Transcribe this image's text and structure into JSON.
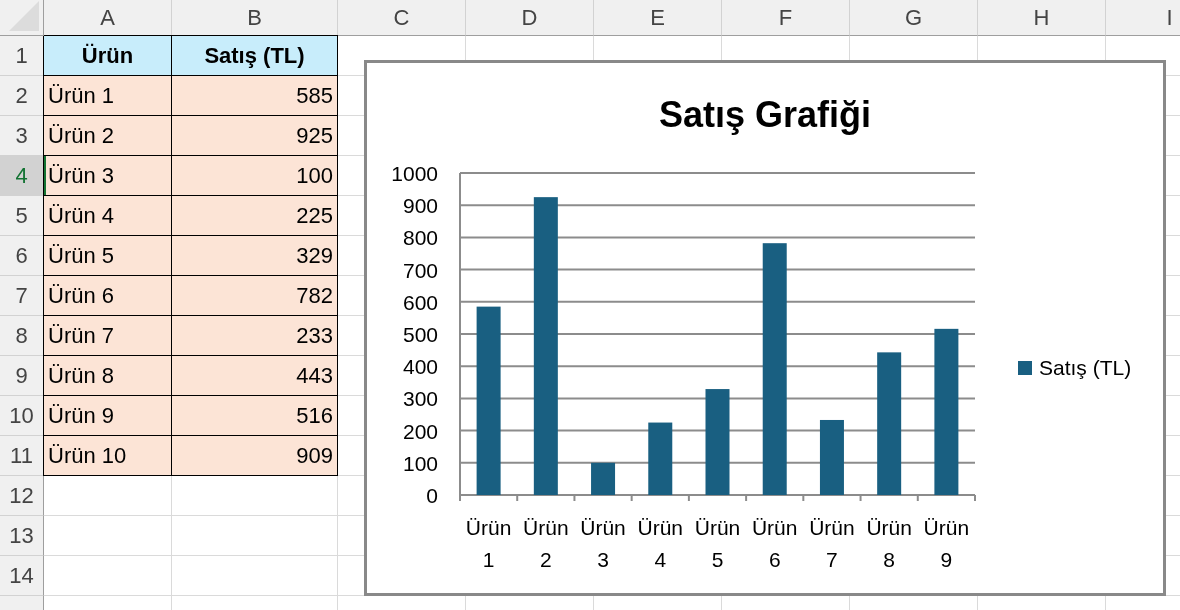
{
  "columns": [
    {
      "label": "A",
      "selected": false
    },
    {
      "label": "B",
      "selected": false
    },
    {
      "label": "C",
      "selected": false
    },
    {
      "label": "D",
      "selected": false
    },
    {
      "label": "E",
      "selected": false
    },
    {
      "label": "F",
      "selected": false
    },
    {
      "label": "G",
      "selected": false
    },
    {
      "label": "H",
      "selected": false
    },
    {
      "label": "I",
      "selected": false
    }
  ],
  "rows": [
    {
      "label": "1",
      "selected": false
    },
    {
      "label": "2",
      "selected": false
    },
    {
      "label": "3",
      "selected": false
    },
    {
      "label": "4",
      "selected": true
    },
    {
      "label": "5",
      "selected": false
    },
    {
      "label": "6",
      "selected": false
    },
    {
      "label": "7",
      "selected": false
    },
    {
      "label": "8",
      "selected": false
    },
    {
      "label": "9",
      "selected": false
    },
    {
      "label": "10",
      "selected": false
    },
    {
      "label": "11",
      "selected": false
    },
    {
      "label": "12",
      "selected": false
    },
    {
      "label": "13",
      "selected": false
    },
    {
      "label": "14",
      "selected": false
    }
  ],
  "table": {
    "columns": [
      "Ürün",
      "Satış (TL)"
    ],
    "rows": [
      [
        "Ürün 1",
        "585"
      ],
      [
        "Ürün 2",
        "925"
      ],
      [
        "Ürün 3",
        "100"
      ],
      [
        "Ürün 4",
        "225"
      ],
      [
        "Ürün 5",
        "329"
      ],
      [
        "Ürün 6",
        "782"
      ],
      [
        "Ürün 7",
        "233"
      ],
      [
        "Ürün 8",
        "443"
      ],
      [
        "Ürün 9",
        "516"
      ],
      [
        "Ürün 10",
        "909"
      ]
    ]
  },
  "chart": {
    "chart_data": {
      "type": "bar",
      "title": "Satış Grafiği",
      "categories": [
        "Ürün 1",
        "Ürün 2",
        "Ürün 3",
        "Ürün 4",
        "Ürün 5",
        "Ürün 6",
        "Ürün 7",
        "Ürün 8",
        "Ürün 9"
      ],
      "series": [
        {
          "name": "Satış (TL)",
          "color": "#195f81",
          "values": [
            585,
            925,
            100,
            225,
            329,
            782,
            233,
            443,
            516
          ]
        }
      ],
      "grid": true,
      "ylim": [
        0,
        1000
      ],
      "yticks": [
        0,
        100,
        200,
        300,
        400,
        500,
        600,
        700,
        800,
        900,
        1000
      ]
    }
  }
}
